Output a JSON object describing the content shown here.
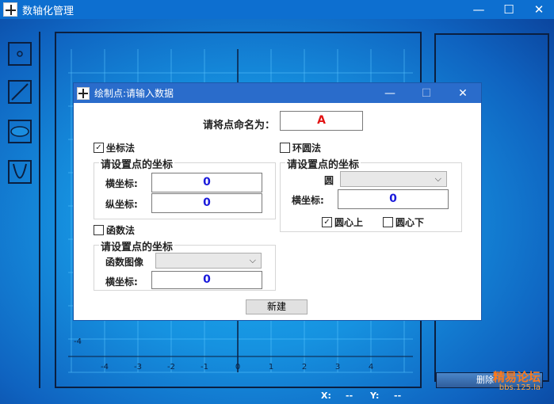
{
  "app": {
    "title": "数轴化管理",
    "controls": {
      "minimize": "—",
      "maximize": "☐",
      "close": "✕"
    }
  },
  "toolbar": {
    "tools": [
      {
        "name": "point-tool",
        "icon": "point-icon"
      },
      {
        "name": "line-tool",
        "icon": "line-icon"
      },
      {
        "name": "ellipse-tool",
        "icon": "ellipse-icon"
      },
      {
        "name": "parabola-tool",
        "icon": "parabola-icon"
      }
    ]
  },
  "canvas": {
    "x_ticks": [
      "-4",
      "-3",
      "-2",
      "-1",
      "0",
      "1",
      "2",
      "3",
      "4"
    ],
    "y_tick_label": "-4"
  },
  "status": {
    "x_label": "X:",
    "x_value": "--",
    "y_label": "Y:",
    "y_value": "--"
  },
  "delete_label": "删除",
  "watermark": {
    "line1": "精易论坛",
    "line2": "bbs.125.la"
  },
  "dialog": {
    "title": "绘制点:请输入数据",
    "name_label": "请将点命名为：",
    "name_value": "A",
    "coord_method": {
      "label": "坐标法",
      "checked": true,
      "group_title": "请设置点的坐标",
      "x_label": "横坐标:",
      "x_value": "0",
      "y_label": "纵坐标:",
      "y_value": "0"
    },
    "ring_method": {
      "label": "环圆法",
      "checked": false,
      "group_title": "请设置点的坐标",
      "circle_label": "圆",
      "x_label": "横坐标:",
      "x_value": "0",
      "on_circle_label": "圆心上",
      "on_circle_checked": true,
      "below_circle_label": "圆心下",
      "below_circle_checked": false
    },
    "function_method": {
      "label": "函数法",
      "checked": false,
      "group_title": "请设置点的坐标",
      "graph_label": "函数图像",
      "x_label": "横坐标:",
      "x_value": "0"
    },
    "create_label": "新建"
  },
  "colors": {
    "accent": "#2a6ccb",
    "value_blue": "#1a1adb",
    "value_red": "#e21212"
  }
}
